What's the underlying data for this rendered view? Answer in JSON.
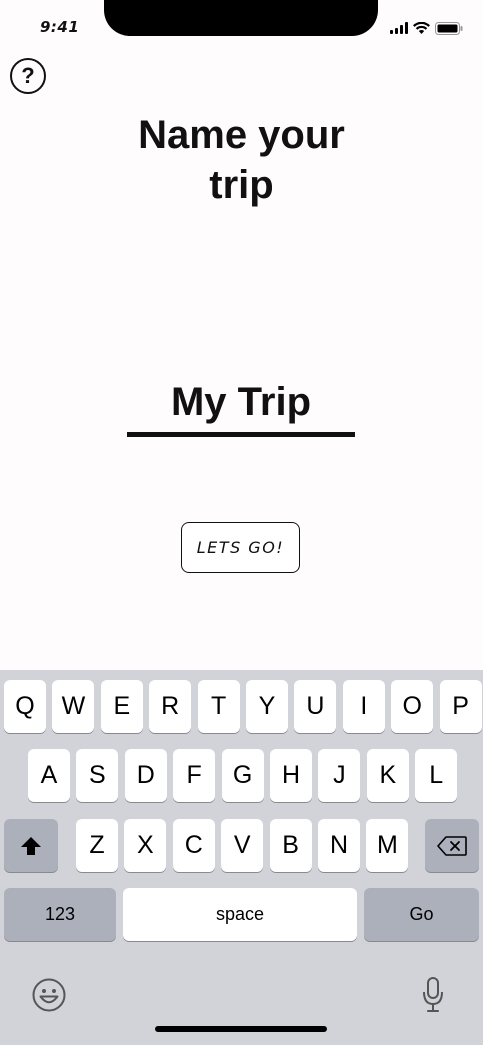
{
  "status": {
    "time": "9:41",
    "signal_icon": "cellular-signal-icon",
    "wifi_icon": "wifi-icon",
    "battery_icon": "battery-icon"
  },
  "help": {
    "label": "?"
  },
  "title": {
    "line1": "Name your",
    "line2": "trip"
  },
  "trip_name": {
    "value": "My Trip"
  },
  "cta": {
    "label": "LETS GO!"
  },
  "keyboard": {
    "row1": [
      "Q",
      "W",
      "E",
      "R",
      "T",
      "Y",
      "U",
      "I",
      "O",
      "P"
    ],
    "row2": [
      "A",
      "S",
      "D",
      "F",
      "G",
      "H",
      "J",
      "K",
      "L"
    ],
    "row3": [
      "Z",
      "X",
      "C",
      "V",
      "B",
      "N",
      "M"
    ],
    "numbers_label": "123",
    "space_label": "space",
    "go_label": "Go",
    "shift_icon": "shift-icon",
    "backspace_icon": "backspace-icon",
    "emoji_icon": "emoji-icon",
    "mic_icon": "microphone-icon"
  }
}
